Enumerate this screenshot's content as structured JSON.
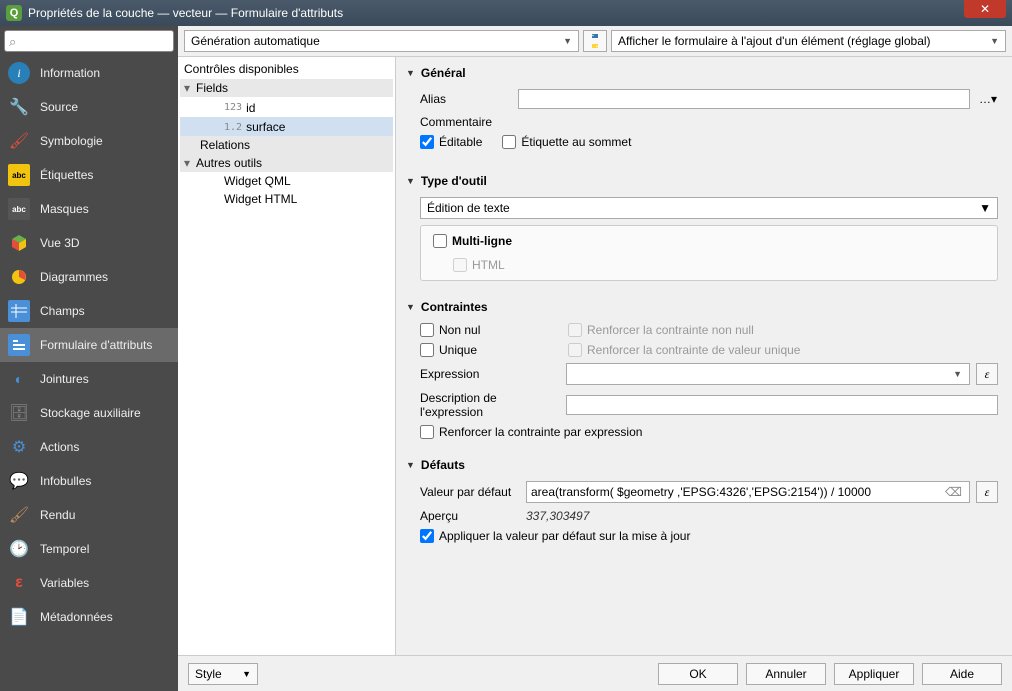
{
  "window": {
    "title": "Propriétés de la couche — vecteur — Formulaire d'attributs"
  },
  "sidebar": {
    "items": [
      {
        "label": "Information",
        "icon": "info"
      },
      {
        "label": "Source",
        "icon": "source"
      },
      {
        "label": "Symbologie",
        "icon": "sym"
      },
      {
        "label": "Étiquettes",
        "icon": "abc"
      },
      {
        "label": "Masques",
        "icon": "abc-dark"
      },
      {
        "label": "Vue 3D",
        "icon": "3d"
      },
      {
        "label": "Diagrammes",
        "icon": "diag"
      },
      {
        "label": "Champs",
        "icon": "champs"
      },
      {
        "label": "Formulaire d'attributs",
        "icon": "form",
        "active": true
      },
      {
        "label": "Jointures",
        "icon": "join"
      },
      {
        "label": "Stockage auxiliaire",
        "icon": "store"
      },
      {
        "label": "Actions",
        "icon": "action"
      },
      {
        "label": "Infobulles",
        "icon": "display"
      },
      {
        "label": "Rendu",
        "icon": "rendu"
      },
      {
        "label": "Temporel",
        "icon": "temp"
      },
      {
        "label": "Variables",
        "icon": "var"
      },
      {
        "label": "Métadonnées",
        "icon": "meta"
      }
    ]
  },
  "topbar": {
    "layout_mode": "Génération automatique",
    "form_display": "Afficher le formulaire à l'ajout d'un élément (réglage global)"
  },
  "tree": {
    "header": "Contrôles disponibles",
    "fields_label": "Fields",
    "field_id": {
      "type": "123",
      "name": "id"
    },
    "field_surface": {
      "type": "1.2",
      "name": "surface"
    },
    "relations_label": "Relations",
    "other_label": "Autres outils",
    "widget_qml": "Widget QML",
    "widget_html": "Widget HTML"
  },
  "general": {
    "title": "Général",
    "alias_label": "Alias",
    "alias_value": "",
    "comment_label": "Commentaire",
    "editable_label": "Éditable",
    "editable_checked": true,
    "label_on_top_label": "Étiquette au sommet",
    "label_on_top_checked": false
  },
  "tool": {
    "title": "Type d'outil",
    "selected": "Édition de texte",
    "multiline_label": "Multi-ligne",
    "multiline_checked": false,
    "html_label": "HTML",
    "html_checked": false
  },
  "constraints": {
    "title": "Contraintes",
    "not_null_label": "Non nul",
    "enforce_not_null_label": "Renforcer la contrainte non null",
    "unique_label": "Unique",
    "enforce_unique_label": "Renforcer la contrainte de valeur unique",
    "expression_label": "Expression",
    "expression_value": "",
    "expr_desc_label": "Description de l'expression",
    "expr_desc_value": "",
    "enforce_expr_label": "Renforcer la contrainte par expression"
  },
  "defaults": {
    "title": "Défauts",
    "default_label": "Valeur par défaut",
    "default_value": "area(transform( $geometry ,'EPSG:4326','EPSG:2154')) / 10000",
    "preview_label": "Aperçu",
    "preview_value": "337,303497",
    "apply_update_label": "Appliquer la valeur par défaut sur la mise à jour",
    "apply_update_checked": true
  },
  "buttons": {
    "style": "Style",
    "ok": "OK",
    "cancel": "Annuler",
    "apply": "Appliquer",
    "help": "Aide"
  }
}
